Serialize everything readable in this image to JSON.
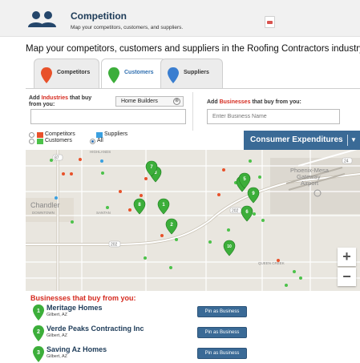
{
  "header": {
    "title": "Competition",
    "subtitle": "Map your competitors, customers, and suppliers."
  },
  "headline": "Map your competitors, customers and suppliers in the Roofing Contractors industry",
  "tabs": [
    {
      "label": "Competitors",
      "color": "#e8512a"
    },
    {
      "label": "Customers",
      "color": "#3cae3a",
      "active": true
    },
    {
      "label": "Suppliers",
      "color": "#3a7ed0"
    }
  ],
  "filters": {
    "industries_prefix": "Add",
    "industries_highlight": "Industries",
    "industries_rest": "that buy",
    "industries_line2": "from you:",
    "industry_chip": "Home Builders",
    "chip_remove": "⊗",
    "industries_input_value": "",
    "businesses_prefix": "Add",
    "businesses_highlight": "Businesses",
    "businesses_rest": "that buy from you:",
    "business_placeholder": "Enter Business Name"
  },
  "legend": {
    "competitors": "Competitors",
    "customers": "Customers",
    "suppliers": "Suppliers",
    "all": "All",
    "colors": {
      "competitors": "#e8512a",
      "customers": "#4cc24a",
      "suppliers": "#3aa0e0"
    }
  },
  "consumer_button": {
    "label": "Consumer Expenditures",
    "caret": "▼"
  },
  "map": {
    "labels": {
      "chandler": "Chandler",
      "chandler_sub": "DOWNTOWN",
      "phoenix_mesa": "Phoenix-Mesa",
      "gateway": "Gateway",
      "airport": "Airport",
      "rd_labels": [
        "87",
        "202",
        "24",
        "202",
        "SANTAN",
        "HIGHLANDS"
      ],
      "queen_creek": "QUEEN CREEK"
    },
    "pins": [
      "1",
      "2",
      "3",
      "4",
      "5",
      "6",
      "7",
      "8",
      "9",
      "10"
    ],
    "zoom_in": "+",
    "zoom_out": "−"
  },
  "businesses": {
    "title": "Businesses that buy from you:",
    "button_label": "Pin as Business",
    "items": [
      {
        "num": "1",
        "name": "Meritage Homes",
        "city": "Gilbert, AZ"
      },
      {
        "num": "2",
        "name": "Verde Peaks Contracting Inc",
        "city": "Gilbert, AZ"
      },
      {
        "num": "3",
        "name": "Saving Az Homes",
        "city": "Gilbert, AZ"
      }
    ]
  }
}
